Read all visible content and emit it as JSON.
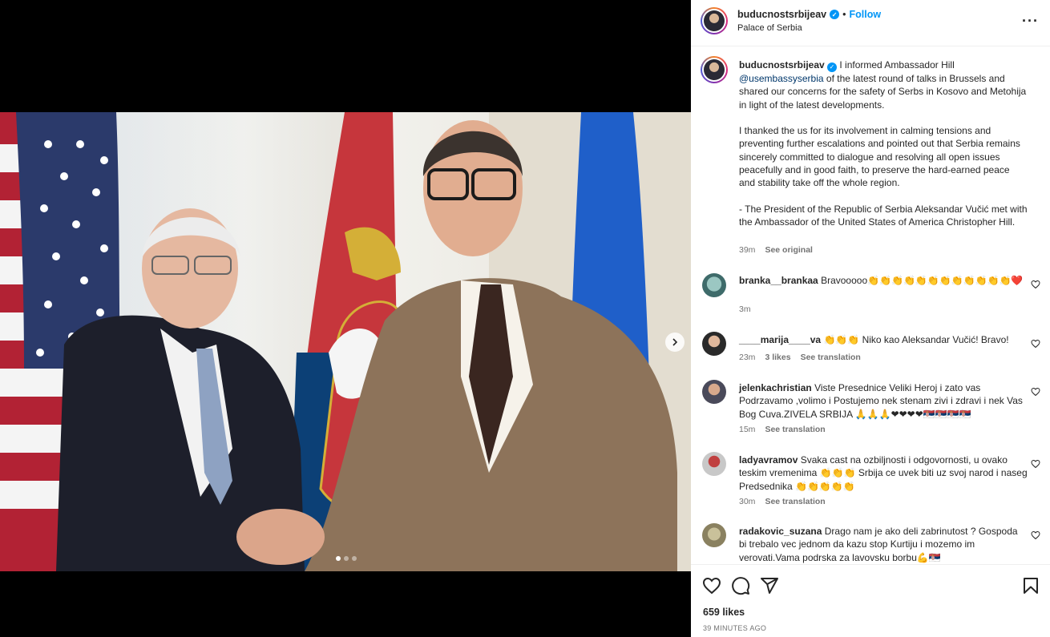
{
  "post": {
    "username": "buducnostsrbijeav",
    "follow_label": "Follow",
    "separator": "•",
    "location": "Palace of Serbia",
    "more_label": "···"
  },
  "caption": {
    "username": "buducnostsrbijeav",
    "text_a": "I informed Ambassador Hill",
    "mention": "@usembassyserbia",
    "text_b": "of the latest round of talks in Brussels and shared our concerns for the safety of Serbs in Kosovo and Metohija in light of the latest developments.",
    "para2": "I thanked the us for its involvement in calming tensions and preventing further escalations and pointed out that Serbia remains sincerely committed to dialogue and resolving all open issues peacefully and in good faith, to preserve the hard-earned peace and stability take off the whole region.",
    "para3": "- The President of the Republic of Serbia Aleksandar Vučić met with the Ambassador of the United States of America Christopher Hill.",
    "time": "39m",
    "see_original": "See original"
  },
  "comments": [
    {
      "username": "branka__brankaa",
      "text": "Bravooooo👏👏👏👏👏👏👏👏👏👏👏👏❤️",
      "time": "3m",
      "likes": "",
      "translation": ""
    },
    {
      "username": "____marija____va",
      "text": "👏👏👏 Niko kao Aleksandar Vučić! Bravo!",
      "time": "23m",
      "likes": "3 likes",
      "translation": "See translation"
    },
    {
      "username": "jelenkachristian",
      "text": "Viste Presednice Veliki Heroj i zato vas Podrzavamo ,volimo i Postujemo nek stenam zivi i zdravi i nek Vas Bog Cuva.ZIVELA SRBIJA 🙏🙏🙏❤❤❤❤🇷🇸🇷🇸🇷🇸🇷🇸",
      "time": "15m",
      "likes": "",
      "translation": "See translation"
    },
    {
      "username": "ladyavramov",
      "text": "Svaka cast na ozbiljnosti i odgovornosti, u ovako teskim vremenima 👏👏👏 Srbija ce uvek biti uz svoj narod i naseg Predsednika 👏👏👏👏👏",
      "time": "30m",
      "likes": "",
      "translation": "See translation"
    },
    {
      "username": "radakovic_suzana",
      "text": "Drago nam je ako deli zabrinutost ? Gospoda bi trebalo vec jednom da kazu stop Kurtiju i mozemo im verovati.Vama podrska za lavovsku borbu💪🇷🇸",
      "time": "",
      "likes": "",
      "translation": ""
    }
  ],
  "footer": {
    "likes": "659 likes",
    "time": "39 MINUTES AGO"
  },
  "carousel": {
    "total": 3,
    "active": 1
  },
  "colors": {
    "accent": "#0095f6",
    "text": "#262626",
    "muted": "#737373",
    "mention": "#00376b"
  },
  "icons": [
    "verified-icon",
    "more-options-icon",
    "heart-icon",
    "comment-icon",
    "share-icon",
    "save-icon",
    "next-arrow-icon"
  ]
}
